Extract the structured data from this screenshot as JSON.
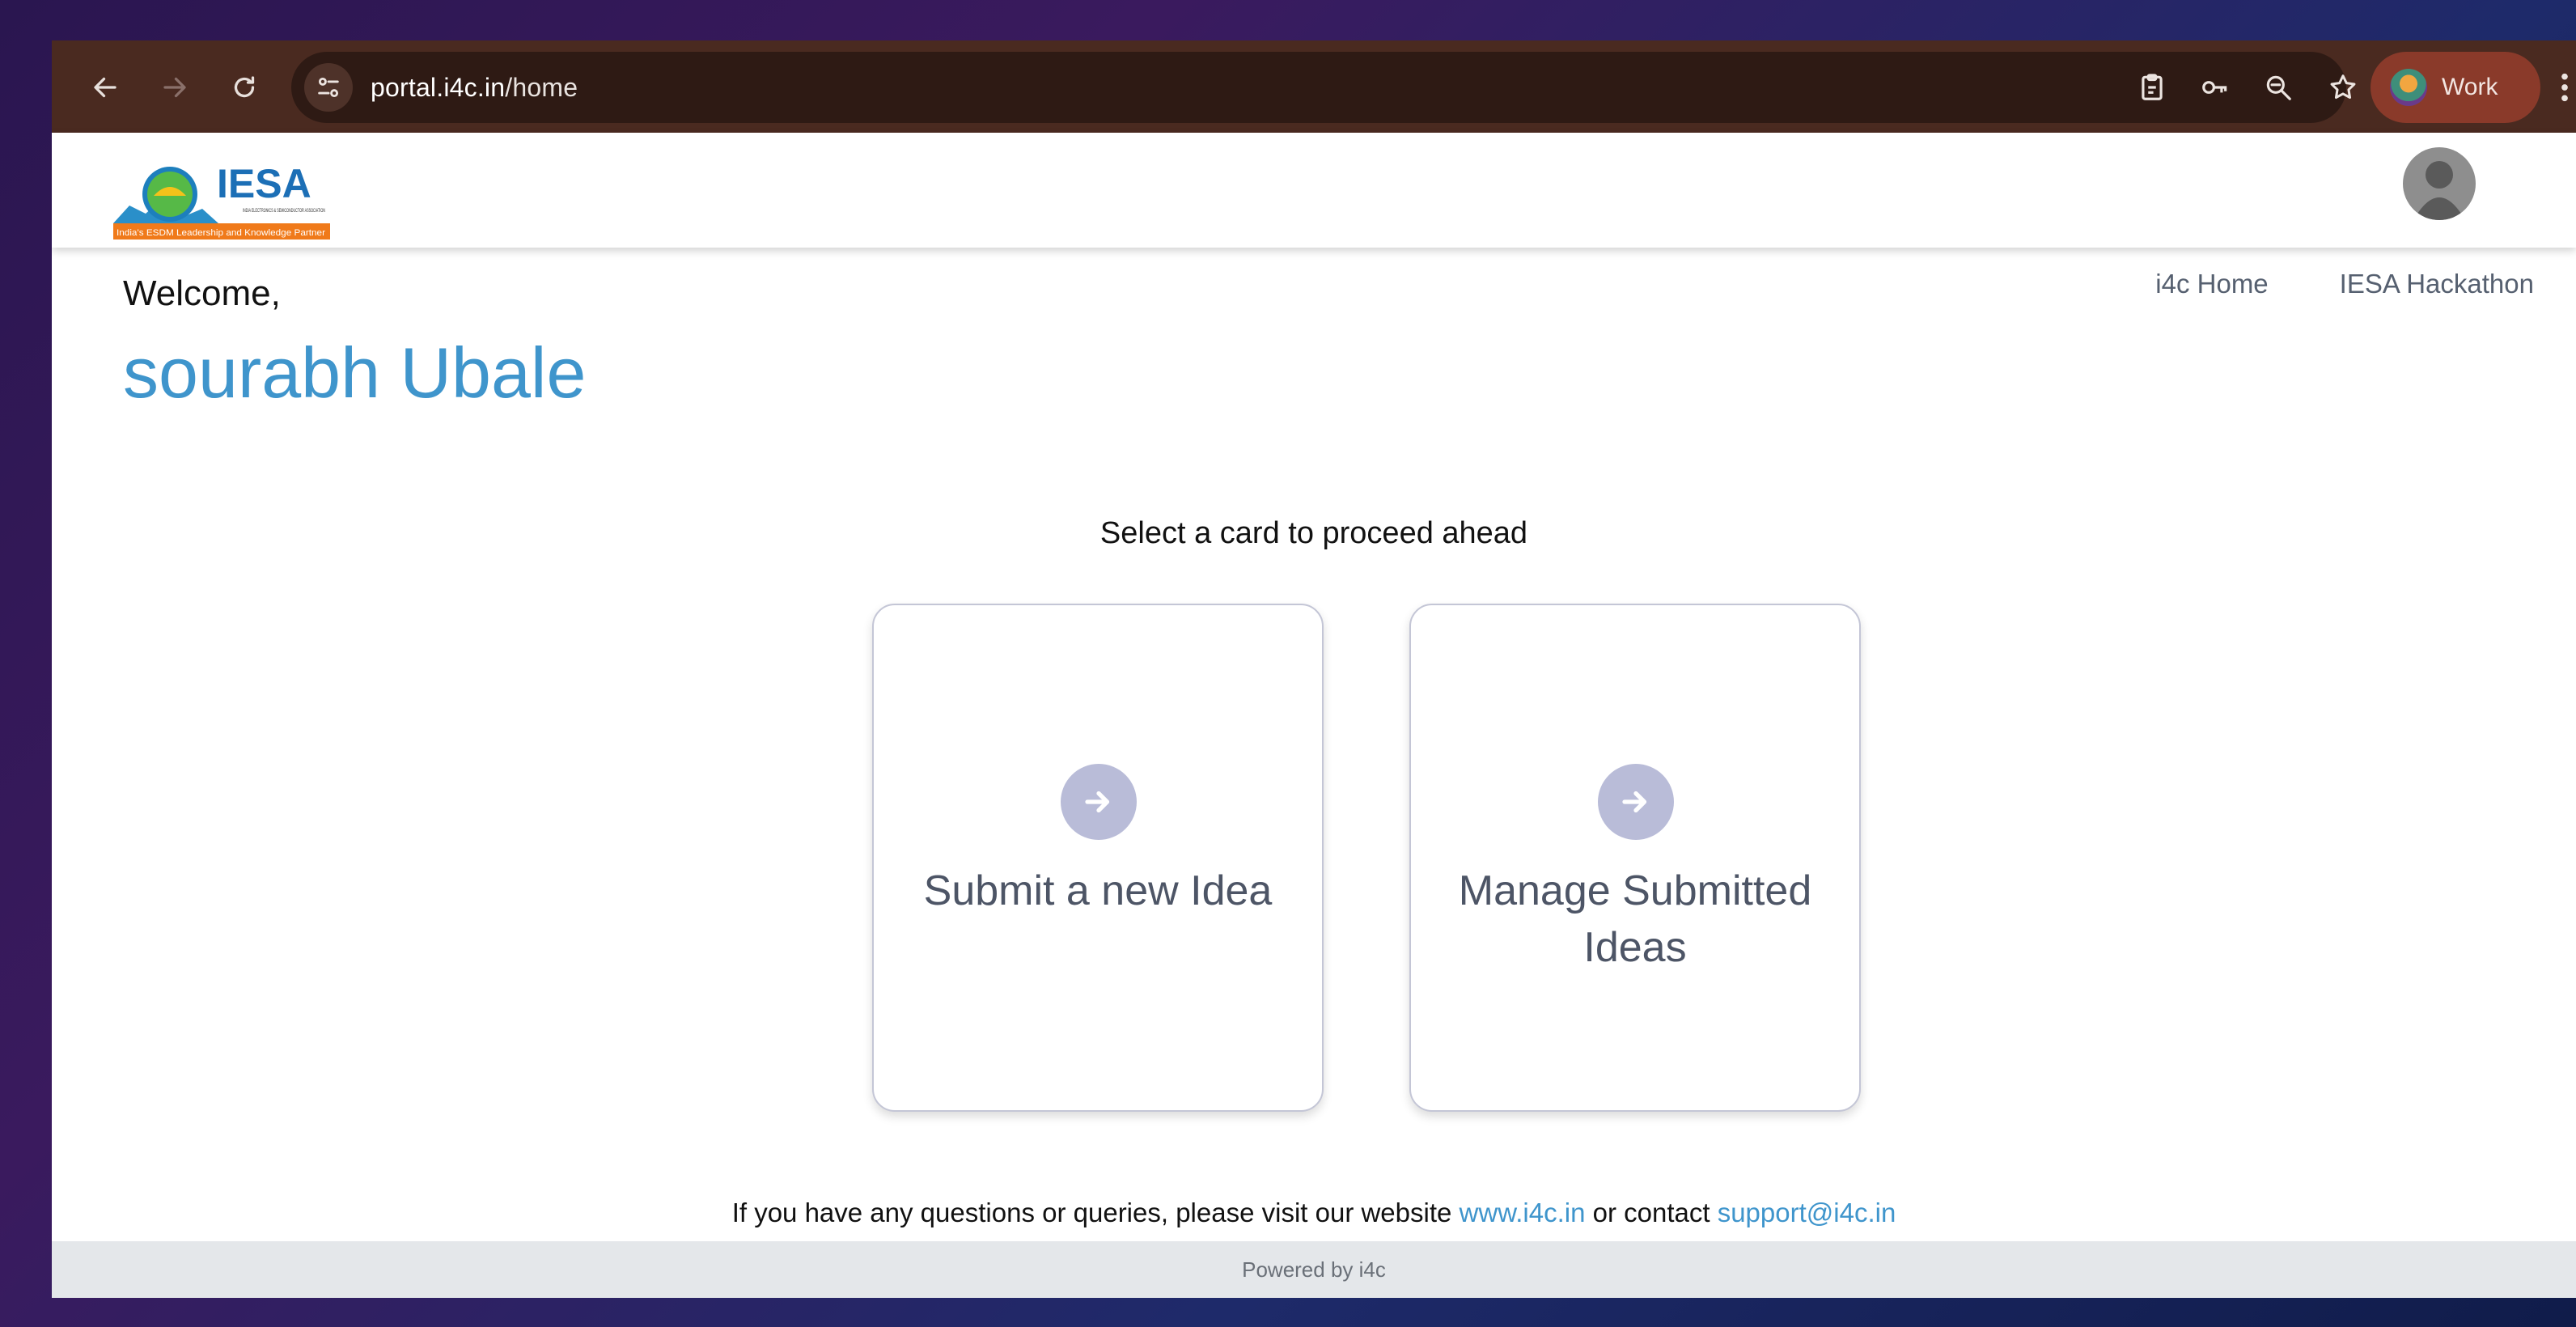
{
  "browser": {
    "url_host": "portal.i4c.in",
    "url_path": "/home",
    "profile_label": "Work",
    "icons": [
      "back-arrow-icon",
      "forward-arrow-icon",
      "reload-icon",
      "site-info-icon",
      "clipboard-icon",
      "key-icon",
      "zoom-icon",
      "star-icon",
      "more-vert-icon"
    ]
  },
  "header": {
    "logo_text": "IESA",
    "logo_subtitle": "INDIA ELECTRONICS & SEMICONDUCTOR ASSOCIATION",
    "logo_tagline": "India's ESDM Leadership and Knowledge Partner"
  },
  "greeting": {
    "welcome": "Welcome,",
    "name": "sourabh Ubale"
  },
  "nav_links": [
    "i4c Home",
    "IESA Hackathon"
  ],
  "prompt": "Select a card to proceed ahead",
  "cards": [
    {
      "title": "Submit a new Idea"
    },
    {
      "title": "Manage Submitted Ideas"
    }
  ],
  "contact": {
    "text_before": "If you have any questions or queries, please visit our website ",
    "website": "www.i4c.in",
    "text_middle": " or contact ",
    "email": "support@i4c.in"
  },
  "footer": "Powered by i4c",
  "colors": {
    "accent": "#3f95cc",
    "chrome_bg": "#4a2a20",
    "card_arrow": "#b9bcd8"
  }
}
